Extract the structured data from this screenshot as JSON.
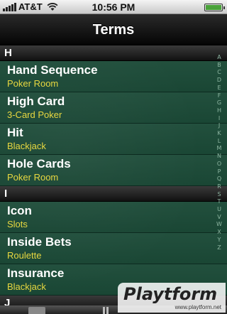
{
  "status": {
    "carrier": "AT&T",
    "time": "10:56 PM",
    "battery_level": 1.0
  },
  "nav": {
    "title": "Terms"
  },
  "sections": [
    {
      "letter": "H",
      "items": [
        {
          "title": "Hand Sequence",
          "subtitle": "Poker Room"
        },
        {
          "title": "High Card",
          "subtitle": "3-Card Poker"
        },
        {
          "title": "Hit",
          "subtitle": "Blackjack"
        },
        {
          "title": "Hole Cards",
          "subtitle": "Poker Room"
        }
      ]
    },
    {
      "letter": "I",
      "items": [
        {
          "title": "Icon",
          "subtitle": "Slots"
        },
        {
          "title": "Inside Bets",
          "subtitle": "Roulette"
        },
        {
          "title": "Insurance",
          "subtitle": "Blackjack"
        }
      ]
    },
    {
      "letter": "J",
      "items": []
    }
  ],
  "index_letters": [
    "A",
    "B",
    "C",
    "D",
    "E",
    "F",
    "G",
    "H",
    "I",
    "J",
    "K",
    "L",
    "M",
    "N",
    "O",
    "P",
    "Q",
    "R",
    "S",
    "T",
    "U",
    "V",
    "W",
    "X",
    "Y",
    "Z"
  ],
  "watermark": {
    "logo": "Playtform",
    "url": "www.playtform.net"
  },
  "colors": {
    "felt": "#1b4a37",
    "subtitle": "#e8d840"
  }
}
